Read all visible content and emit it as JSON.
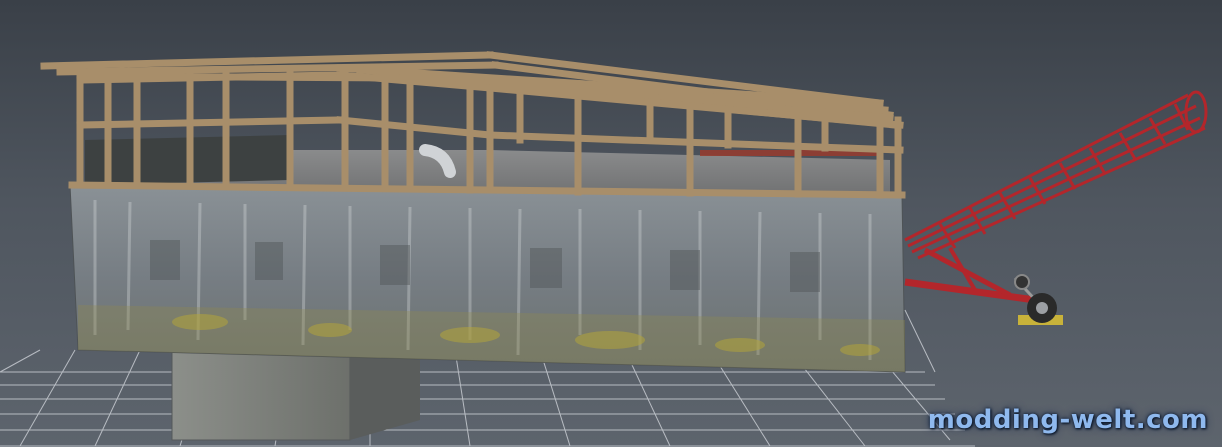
{
  "viewport": {
    "background_top": "#3a4048",
    "background_bottom": "#5d646d",
    "grid_color": "#c8ccd2"
  },
  "scene_objects": {
    "building": {
      "wall_texture": "weathered concrete",
      "frame_texture": "wood",
      "wall_color": "#7d8388",
      "frame_color": "#a88e6a"
    },
    "conveyor": {
      "color": "#b3262b",
      "wheel_color": "#2a2a2a"
    }
  },
  "watermark": {
    "text": "modding-welt.com",
    "color": "#8fb9ee"
  }
}
